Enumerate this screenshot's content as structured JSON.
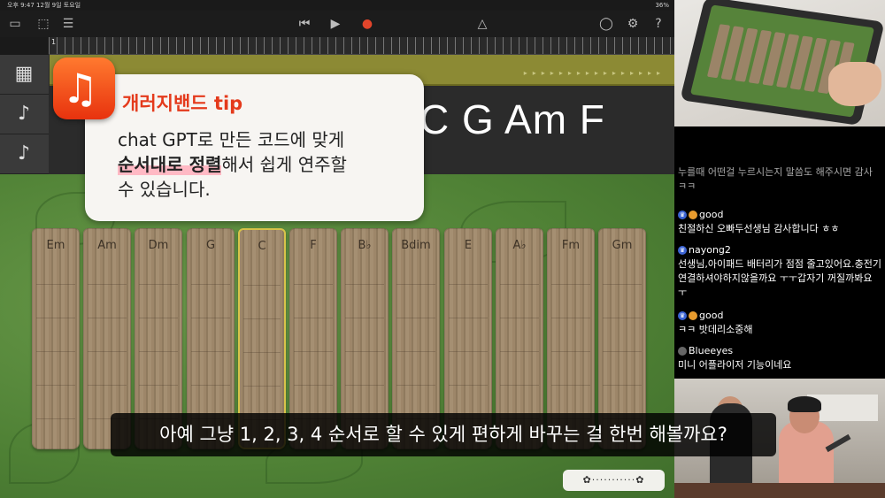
{
  "status": {
    "left": "오후 9:47  12월 9일 토요일",
    "right": "36%"
  },
  "toolbar": {
    "icons": [
      "browser-icon",
      "track-view-icon",
      "mixer-icon",
      "rewind-icon",
      "play-icon",
      "record-icon",
      "metronome-icon",
      "loop-icon",
      "settings-icon",
      "help-icon"
    ],
    "glyphs": {
      "browser": "▭",
      "trackview": "⬚",
      "mixer": "☰",
      "rewind": "⏮",
      "play": "▶",
      "record": "●",
      "metronome": "△",
      "loop": "◯",
      "settings": "⚙",
      "help": "?"
    }
  },
  "ruler": {
    "marks": [
      "1"
    ]
  },
  "chords_overlay": "C G Am F",
  "strips": [
    "Em",
    "Am",
    "Dm",
    "G",
    "C",
    "F",
    "B♭",
    "Bdim",
    "E",
    "A♭",
    "Fm",
    "Gm"
  ],
  "selected_strip": 4,
  "tip": {
    "title": "개러지밴드 tip",
    "body_line1": "chat GPT로 만든 코드에 맞게",
    "highlight": "순서대로 정렬",
    "body_line2_rest": "해서 쉽게 연주할",
    "body_line3": "수 있습니다."
  },
  "mini_control": "✿···········✿",
  "subtitle": "아예 그냥 1, 2, 3, 4 순서로 할 수 있게 편하게 바꾸는 걸 한번 해볼까요?",
  "chat": [
    {
      "user": "",
      "text": "누를때 어떤걸 누르시는지 말씀도 해주시면 감사 ㅋㅋ",
      "faded": true
    },
    {
      "user": "good",
      "text": "친절하신 오빠두선생님 감사합니다 ㅎㅎ"
    },
    {
      "user": "nayong2",
      "text": "선생님,아이패드 배터리가 점점 줄고있어요.충전기 연결하셔야하지않을까요 ㅜㅜ갑자기 꺼질까봐요 ㅜ"
    },
    {
      "user": "good",
      "text": "ㅋㅋ 밧데리소중해"
    },
    {
      "user": "Blueeyes",
      "text": "미니 어플라이저 기능이네요"
    }
  ],
  "colors": {
    "accent": "#e43a1c",
    "region": "#8c8a34",
    "highlight": "#ffb9c4"
  }
}
